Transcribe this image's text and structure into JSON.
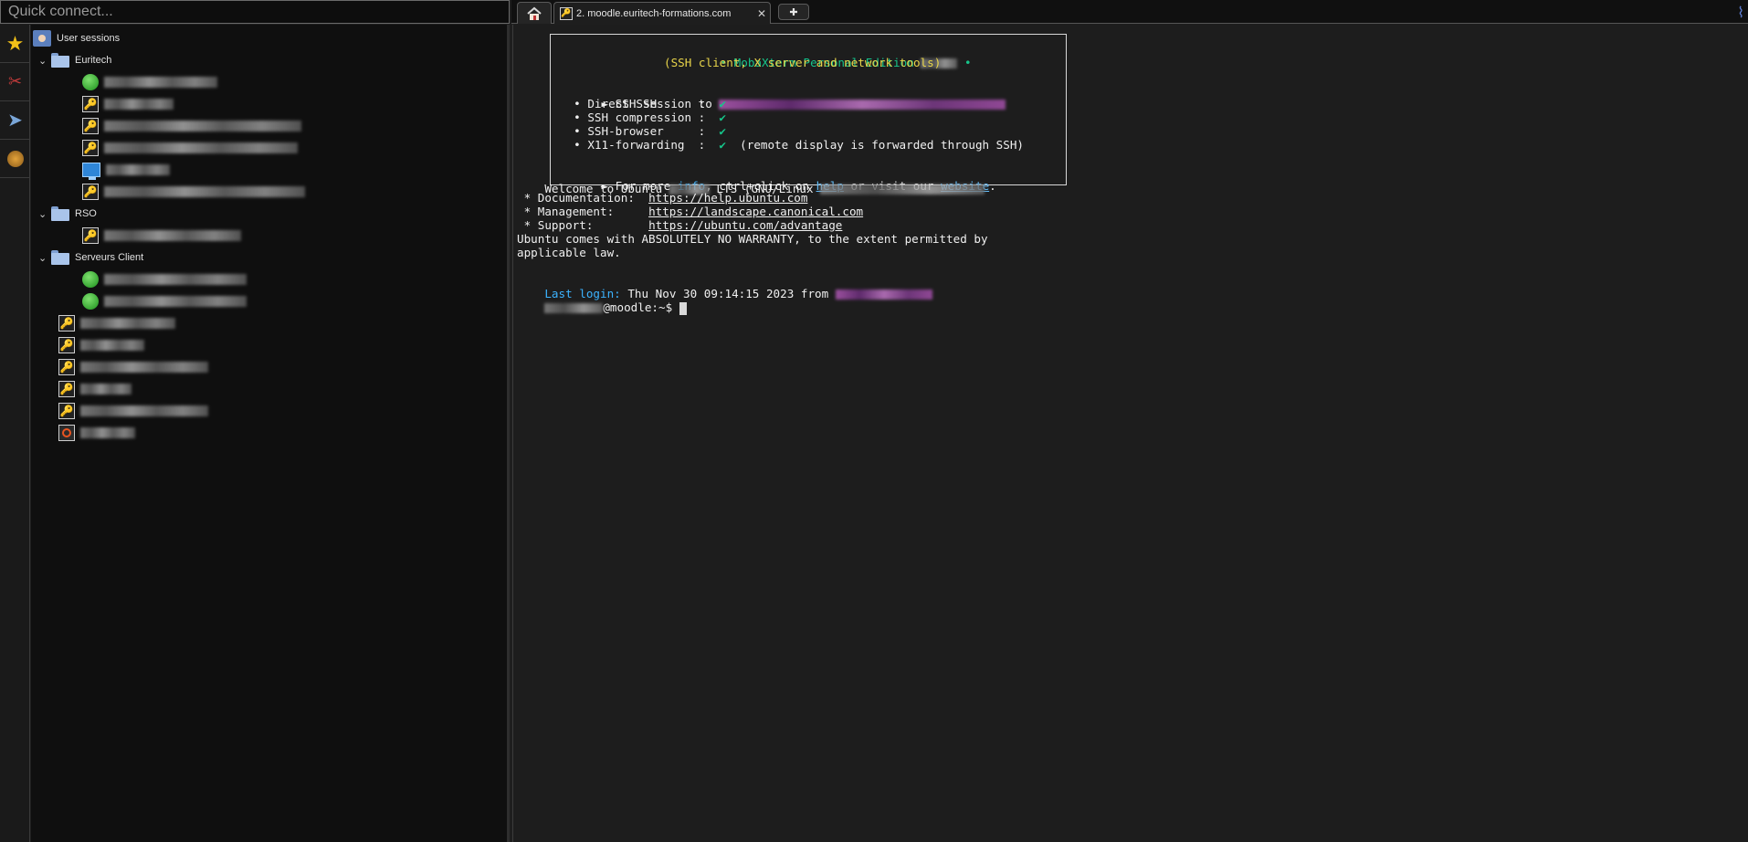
{
  "quick_connect": {
    "placeholder": "Quick connect..."
  },
  "tabs": {
    "session_label": "2. moodle.euritech-formations.com",
    "close_glyph": "✕",
    "new_glyph": "✚"
  },
  "sidebar": {
    "root": "User sessions",
    "folders": [
      {
        "name": "Euritech"
      },
      {
        "name": "RSO"
      },
      {
        "name": "Serveurs Client"
      }
    ],
    "icons": [
      "star-icon",
      "tools-icon",
      "send-icon",
      "macro-icon"
    ]
  },
  "terminal": {
    "banner": {
      "edition": "• MobaXterm Personal Edition ",
      "edition_end": " •",
      "subtitle": "(SSH client, X server and network tools)",
      "ssh_session": "► SSH session to ",
      "direct_ssh": "  • Direct SSH      :  ",
      "compression": "  • SSH compression :  ",
      "browser": "  • SSH-browser     :  ",
      "x11": "  • X11-forwarding  :  ",
      "check": "✔",
      "x11_note": "  (remote display is forwarded through SSH)",
      "more_a": "► For more ",
      "more_info": "info",
      "more_b": ", ctrl+click on ",
      "more_help": "help",
      "more_c": " or visit our ",
      "more_website": "website",
      "more_d": "."
    },
    "welcome_a": "Welcome to Ubuntu ",
    "welcome_b": " LTS (GNU/Linux ",
    "doc_label": " * Documentation:  ",
    "doc_url": "https://help.ubuntu.com",
    "mgmt_label": " * Management:     ",
    "mgmt_url": "https://landscape.canonical.com",
    "support_label": " * Support:        ",
    "support_url": "https://ubuntu.com/advantage",
    "warranty_1": "Ubuntu comes with ABSOLUTELY NO WARRANTY, to the extent permitted by",
    "warranty_2": "applicable law.",
    "last_login_label": "Last login:",
    "last_login_value": " Thu Nov 30 09:14:15 2023 from ",
    "prompt": "@moodle:~$ "
  },
  "colors": {
    "accent_green": "#16c58a",
    "accent_yellow": "#e9d54a",
    "link": "#62c0ff"
  }
}
